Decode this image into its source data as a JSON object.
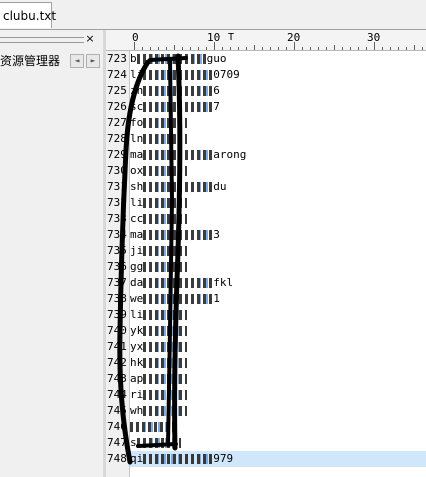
{
  "tab": {
    "filename": "clubu.txt"
  },
  "left_panel": {
    "close_glyph": "×",
    "title": "资源管理器",
    "nav_prev": "◄",
    "nav_next": "►"
  },
  "ruler": {
    "labels": [
      "0",
      "10",
      "20",
      "30"
    ],
    "caret": "T"
  },
  "lines": [
    {
      "num": "723",
      "prefix": "b",
      "suffix": "guo"
    },
    {
      "num": "724",
      "prefix": "li",
      "suffix": "0709"
    },
    {
      "num": "725",
      "prefix": "zh",
      "suffix": "6"
    },
    {
      "num": "726",
      "prefix": "sc",
      "suffix": "7"
    },
    {
      "num": "727",
      "prefix": "fo",
      "suffix": ""
    },
    {
      "num": "728",
      "prefix": "ln",
      "suffix": ""
    },
    {
      "num": "729",
      "prefix": "ma",
      "suffix": "arong"
    },
    {
      "num": "730",
      "prefix": "ox",
      "suffix": ""
    },
    {
      "num": "731",
      "prefix": "sh",
      "suffix": "du"
    },
    {
      "num": "732",
      "prefix": "li",
      "suffix": ""
    },
    {
      "num": "733",
      "prefix": "cc",
      "suffix": ""
    },
    {
      "num": "734",
      "prefix": "ma",
      "suffix": "3"
    },
    {
      "num": "735",
      "prefix": "ji",
      "suffix": ""
    },
    {
      "num": "736",
      "prefix": "gg",
      "suffix": ""
    },
    {
      "num": "737",
      "prefix": "da",
      "suffix": "fkl"
    },
    {
      "num": "738",
      "prefix": "we",
      "suffix": "1"
    },
    {
      "num": "739",
      "prefix": "li",
      "suffix": ""
    },
    {
      "num": "740",
      "prefix": "yk",
      "suffix": ""
    },
    {
      "num": "741",
      "prefix": "yx",
      "suffix": ""
    },
    {
      "num": "742",
      "prefix": "hk",
      "suffix": ""
    },
    {
      "num": "743",
      "prefix": "ap",
      "suffix": ""
    },
    {
      "num": "744",
      "prefix": "ri",
      "suffix": ""
    },
    {
      "num": "745",
      "prefix": "wh",
      "suffix": ""
    },
    {
      "num": "746",
      "prefix": "",
      "suffix": ""
    },
    {
      "num": "747",
      "prefix": "s",
      "suffix": ""
    },
    {
      "num": "748",
      "prefix": "qi",
      "suffix": "979"
    }
  ],
  "current_line_index": 25,
  "colors": {
    "current_line": "#cfe6fb",
    "scribble": "#000000"
  }
}
